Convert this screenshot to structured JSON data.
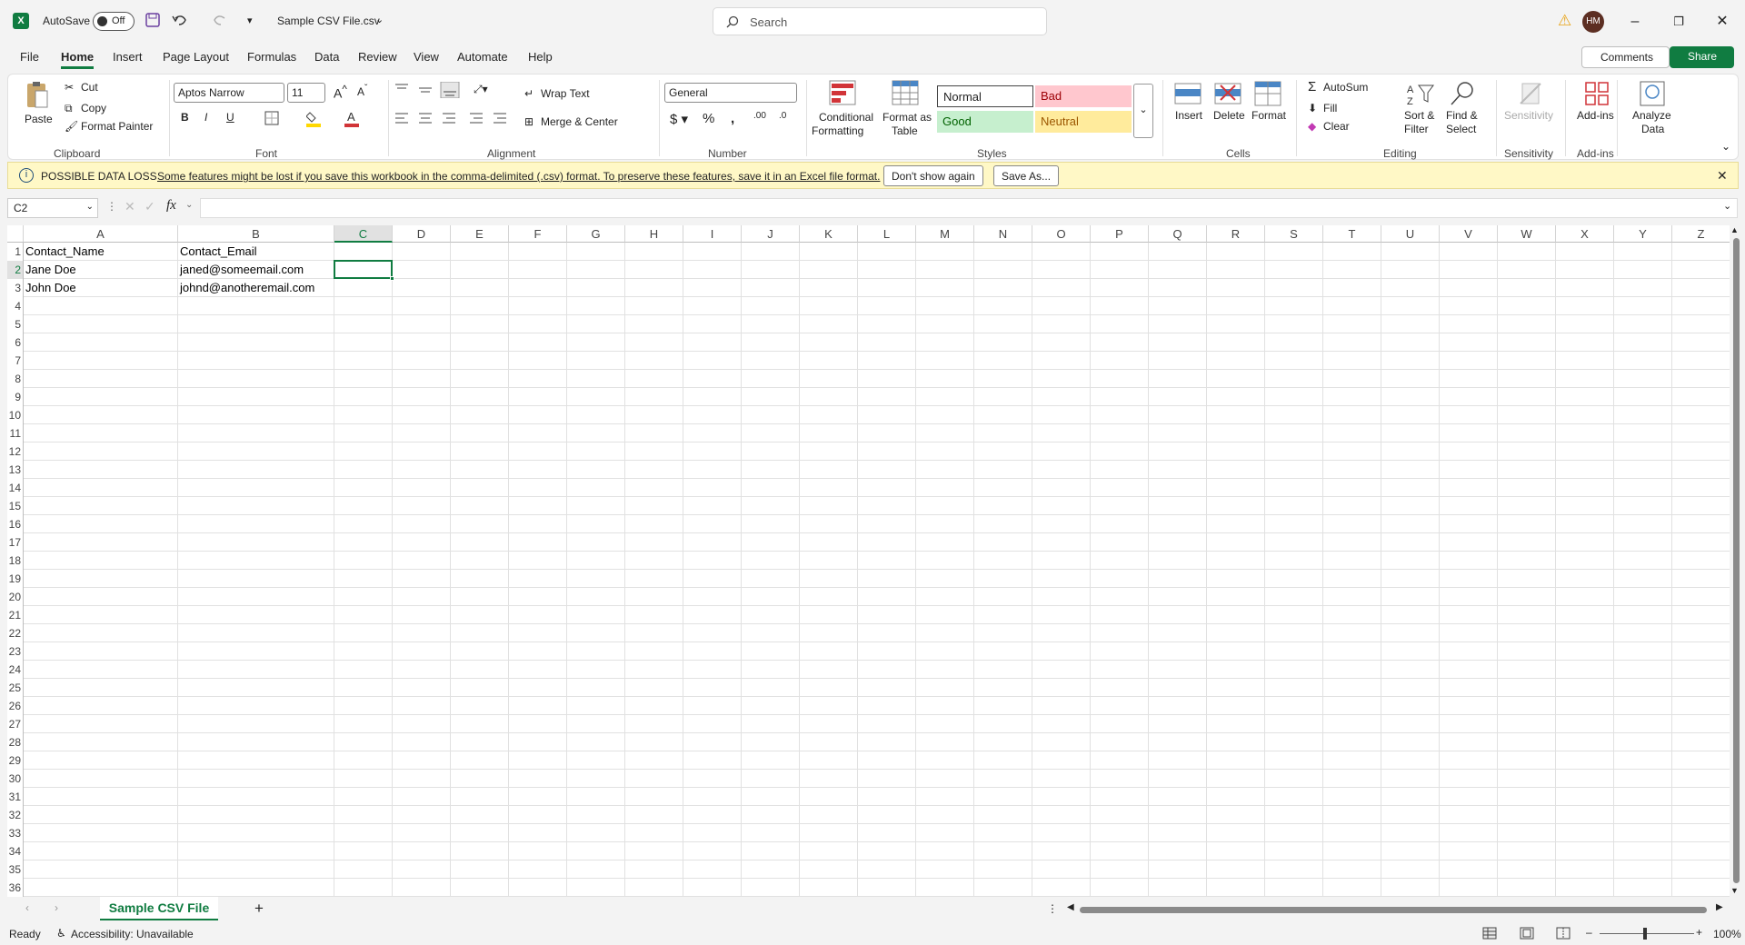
{
  "app": {
    "autosave_label": "AutoSave",
    "autosave_state": "Off",
    "filename": "Sample CSV File.csv",
    "search_placeholder": "Search",
    "avatar": "HM"
  },
  "colors": {
    "accent": "#107c41",
    "bad": "#ffc7ce",
    "good": "#c6efce",
    "neutral": "#ffeb9c",
    "infobar": "#fff8c6"
  },
  "menu": {
    "tabs": [
      "File",
      "Home",
      "Insert",
      "Page Layout",
      "Formulas",
      "Data",
      "Review",
      "View",
      "Automate",
      "Help"
    ],
    "active": "Home",
    "comments": "Comments",
    "share": "Share"
  },
  "ribbon": {
    "clipboard": {
      "paste": "Paste",
      "cut": "Cut",
      "copy": "Copy",
      "format_painter": "Format Painter",
      "group": "Clipboard"
    },
    "font": {
      "name": "Aptos Narrow",
      "size": "11",
      "group": "Font",
      "bold": "B",
      "italic": "I",
      "underline": "U"
    },
    "alignment": {
      "wrap": "Wrap Text",
      "merge": "Merge & Center",
      "group": "Alignment"
    },
    "number": {
      "format": "General",
      "group": "Number"
    },
    "styles": {
      "conditional": "Conditional",
      "conditional2": "Formatting",
      "format_as": "Format as",
      "format_as2": "Table",
      "normal": "Normal",
      "bad": "Bad",
      "good": "Good",
      "neutral": "Neutral",
      "group": "Styles"
    },
    "cells": {
      "insert": "Insert",
      "delete": "Delete",
      "format": "Format",
      "group": "Cells"
    },
    "editing": {
      "autosum": "AutoSum",
      "fill": "Fill",
      "clear": "Clear",
      "sort": "Sort &",
      "sort2": "Filter",
      "find": "Find &",
      "find2": "Select",
      "group": "Editing"
    },
    "sensitivity": {
      "label": "Sensitivity",
      "group": "Sensitivity"
    },
    "addins": {
      "label": "Add-ins",
      "group": "Add-ins"
    },
    "analyze": {
      "label": "Analyze",
      "label2": "Data"
    }
  },
  "infobar": {
    "title": "POSSIBLE DATA LOSS",
    "message": "Some features might be lost if you save this workbook in the comma-delimited (.csv) format. To preserve these features, save it in an Excel file format.",
    "dont_show": "Don't show again",
    "save_as": "Save As..."
  },
  "formula": {
    "namebox": "C2",
    "content": ""
  },
  "grid": {
    "columns": [
      "A",
      "B",
      "C",
      "D",
      "E",
      "F",
      "G",
      "H",
      "I",
      "J",
      "K",
      "L",
      "M",
      "N",
      "O",
      "P",
      "Q",
      "R",
      "S",
      "T",
      "U",
      "V",
      "W",
      "X",
      "Y",
      "Z"
    ],
    "selected_col": "C",
    "selected_row": 2,
    "rows": 36,
    "cells": {
      "A1": "Contact_Name",
      "B1": "Contact_Email",
      "A2": "Jane Doe",
      "B2": "janed@someemail.com",
      "A3": "John Doe",
      "B3": "johnd@anotheremail.com"
    }
  },
  "sheet": {
    "tab": "Sample CSV File"
  },
  "status": {
    "ready": "Ready",
    "accessibility": "Accessibility: Unavailable",
    "zoom": "100%"
  }
}
